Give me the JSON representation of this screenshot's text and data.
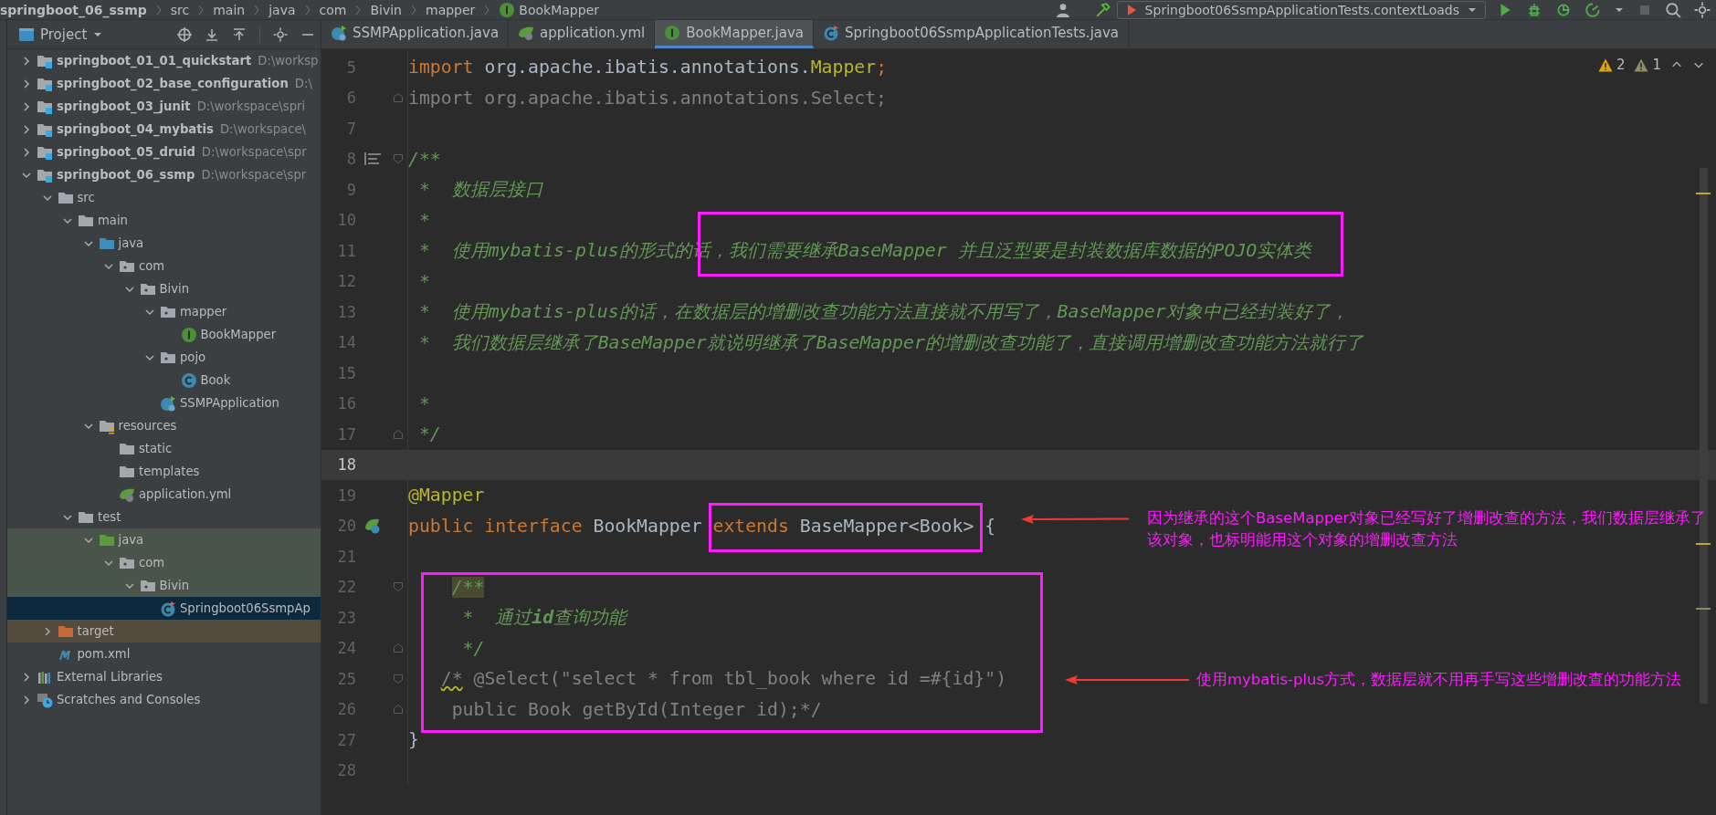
{
  "breadcrumb": [
    {
      "label": "springboot_06_ssmp"
    },
    {
      "label": "src"
    },
    {
      "label": "main"
    },
    {
      "label": "java"
    },
    {
      "label": "com"
    },
    {
      "label": "Bivin"
    },
    {
      "label": "mapper"
    },
    {
      "label": "BookMapper",
      "kind": "interface"
    }
  ],
  "run_config": {
    "label": "Springboot06SsmpApplicationTests.contextLoads"
  },
  "project_panel": {
    "title": "Project"
  },
  "tree": [
    {
      "label": "springboot_01_01_quickstart",
      "path": "D:\\worksp",
      "kind": "module",
      "expanded": false,
      "selected": false
    },
    {
      "label": "springboot_02_base_configuration",
      "path": "D:\\",
      "kind": "module",
      "expanded": false,
      "selected": false
    },
    {
      "label": "springboot_03_junit",
      "path": "D:\\workspace\\spri",
      "kind": "module",
      "expanded": false,
      "selected": false
    },
    {
      "label": "springboot_04_mybatis",
      "path": "D:\\workspace\\",
      "kind": "module",
      "expanded": false,
      "selected": false
    },
    {
      "label": "springboot_05_druid",
      "path": "D:\\workspace\\spr",
      "kind": "module",
      "expanded": false,
      "selected": false
    },
    {
      "label": "springboot_06_ssmp",
      "path": "D:\\workspace\\spr",
      "kind": "module",
      "expanded": true,
      "selected": false,
      "children": [
        {
          "label": "src",
          "kind": "folder",
          "expanded": true,
          "selected": false,
          "children": [
            {
              "label": "main",
              "kind": "folder",
              "expanded": true,
              "selected": false,
              "children": [
                {
                  "label": "java",
                  "kind": "source",
                  "expanded": true,
                  "selected": false,
                  "children": [
                    {
                      "label": "com",
                      "kind": "package",
                      "expanded": true,
                      "selected": false,
                      "children": [
                        {
                          "label": "Bivin",
                          "kind": "package",
                          "expanded": true,
                          "selected": false,
                          "children": [
                            {
                              "label": "mapper",
                              "kind": "package",
                              "expanded": true,
                              "selected": false,
                              "children": [
                                {
                                  "label": "BookMapper",
                                  "kind": "interface",
                                  "selected": false
                                }
                              ]
                            },
                            {
                              "label": "pojo",
                              "kind": "package",
                              "expanded": true,
                              "selected": false,
                              "children": [
                                {
                                  "label": "Book",
                                  "kind": "class",
                                  "selected": false
                                }
                              ]
                            },
                            {
                              "label": "SSMPApplication",
                              "kind": "spring-app",
                              "selected": false
                            }
                          ]
                        }
                      ]
                    }
                  ]
                },
                {
                  "label": "resources",
                  "kind": "resources",
                  "expanded": true,
                  "selected": false,
                  "children": [
                    {
                      "label": "static",
                      "kind": "folder",
                      "selected": false
                    },
                    {
                      "label": "templates",
                      "kind": "folder",
                      "selected": false
                    },
                    {
                      "label": "application.yml",
                      "kind": "spring-config",
                      "selected": false
                    }
                  ]
                }
              ]
            },
            {
              "label": "test",
              "kind": "folder",
              "expanded": true,
              "selected": false,
              "children": [
                {
                  "label": "java",
                  "kind": "test-source",
                  "expanded": true,
                  "selected": false,
                  "in_test": true,
                  "children": [
                    {
                      "label": "com",
                      "kind": "package",
                      "expanded": true,
                      "selected": false,
                      "in_test": true,
                      "children": [
                        {
                          "label": "Bivin",
                          "kind": "package",
                          "expanded": true,
                          "selected": false,
                          "in_test": true,
                          "children": [
                            {
                              "label": "Springboot06SsmpAp",
                              "kind": "test-class",
                              "selected": true
                            }
                          ]
                        }
                      ]
                    }
                  ]
                }
              ]
            }
          ]
        },
        {
          "label": "target",
          "kind": "excluded",
          "expanded": false,
          "selected": false,
          "excluded": true
        },
        {
          "label": "pom.xml",
          "kind": "maven",
          "selected": false
        }
      ]
    },
    {
      "label": "External Libraries",
      "kind": "libraries",
      "expanded": false,
      "selected": false
    },
    {
      "label": "Scratches and Consoles",
      "kind": "scratches",
      "expanded": false,
      "selected": false
    }
  ],
  "editor_tabs": [
    {
      "label": "SSMPApplication.java",
      "kind": "spring-app",
      "selected": false
    },
    {
      "label": "application.yml",
      "kind": "spring-config",
      "selected": false
    },
    {
      "label": "BookMapper.java",
      "kind": "interface",
      "selected": true
    },
    {
      "label": "Springboot06SsmpApplicationTests.java",
      "kind": "test-class",
      "selected": false
    }
  ],
  "inspections": [
    {
      "kind": "warning",
      "count": "2"
    },
    {
      "kind": "weak-warning",
      "count": "1"
    }
  ],
  "code_lines": [
    {
      "number": "5",
      "current": false,
      "segments": [
        {
          "kind": "keyword",
          "text": "import "
        },
        {
          "kind": "plain",
          "text": "org.apache.ibatis.annotations."
        },
        {
          "kind": "annotation",
          "text": "Mapper"
        },
        {
          "kind": "keyword",
          "text": ";"
        }
      ]
    },
    {
      "number": "6",
      "current": false,
      "fold_end": true,
      "segments": [
        {
          "kind": "unused",
          "text": "import org.apache.ibatis.annotations.Select;"
        }
      ]
    },
    {
      "number": "7",
      "current": false
    },
    {
      "number": "8",
      "current": false,
      "fold_start": true,
      "rendered_doc": true,
      "segments": [
        {
          "kind": "doc",
          "text": "/**"
        }
      ]
    },
    {
      "number": "9",
      "current": false,
      "segments": [
        {
          "kind": "doc",
          "text": " *  数据层接口"
        }
      ]
    },
    {
      "number": "10",
      "current": false,
      "segments": [
        {
          "kind": "doc",
          "text": " *"
        }
      ]
    },
    {
      "number": "11",
      "current": false,
      "segments": [
        {
          "kind": "doc",
          "text": " *  使用mybatis-plus的形式的话，我们需要继承BaseMapper 并且泛型要是封装数据库数据的POJO实体类"
        }
      ]
    },
    {
      "number": "12",
      "current": false,
      "segments": [
        {
          "kind": "doc",
          "text": " *"
        }
      ]
    },
    {
      "number": "13",
      "current": false,
      "segments": [
        {
          "kind": "doc",
          "text": " *  使用mybatis-plus的话，在数据层的增删改查功能方法直接就不用写了，BaseMapper对象中已经封装好了，"
        }
      ]
    },
    {
      "number": "14",
      "current": false,
      "segments": [
        {
          "kind": "doc",
          "text": " *  我们数据层继承了BaseMapper就说明继承了BaseMapper的增删改查功能了，直接调用增删改查功能方法就行了"
        }
      ]
    },
    {
      "number": "15",
      "current": false
    },
    {
      "number": "16",
      "current": false,
      "segments": [
        {
          "kind": "doc",
          "text": " *"
        }
      ]
    },
    {
      "number": "17",
      "current": false,
      "fold_end": true,
      "segments": [
        {
          "kind": "doc",
          "text": " */"
        }
      ]
    },
    {
      "number": "18",
      "current": true
    },
    {
      "number": "19",
      "current": false,
      "segments": [
        {
          "kind": "annotation",
          "text": "@Mapper"
        }
      ]
    },
    {
      "number": "20",
      "current": false,
      "bean": true,
      "segments": [
        {
          "kind": "keyword",
          "text": "public interface "
        },
        {
          "kind": "plain",
          "text": "BookMapper "
        },
        {
          "kind": "keyword",
          "text": "extends "
        },
        {
          "kind": "plain",
          "text": "BaseMapper<Book> {"
        }
      ]
    },
    {
      "number": "21",
      "current": false
    },
    {
      "number": "22",
      "current": false,
      "fold_start": true,
      "segments": [
        {
          "kind": "doc-marked",
          "text": "    /**"
        }
      ]
    },
    {
      "number": "23",
      "current": false,
      "segments": [
        {
          "kind": "doc",
          "text": "     *  通过**id**查询功能"
        }
      ]
    },
    {
      "number": "24",
      "current": false,
      "fold_end": true,
      "segments": [
        {
          "kind": "doc",
          "text": "     */"
        }
      ]
    },
    {
      "number": "25",
      "current": false,
      "fold_start": true,
      "segments": [
        {
          "kind": "comment-typo",
          "text": "   /*"
        },
        {
          "kind": "comment",
          "text": " @Select(\"select * from tbl_book where id =#{id}\")"
        }
      ]
    },
    {
      "number": "26",
      "current": false,
      "fold_end": true,
      "segments": [
        {
          "kind": "comment",
          "text": "    public Book getById(Integer id);*/"
        }
      ]
    },
    {
      "number": "27",
      "current": false,
      "segments": [
        {
          "kind": "plain",
          "text": "}"
        }
      ]
    },
    {
      "number": "28",
      "current": false
    }
  ],
  "notes": [
    {
      "text": "因为继承的这个BaseMapper对象已经写好了增删改查的方法，我们数据层继承了该对象，也标明能用这个对象的增删改查方法"
    },
    {
      "text": "使用mybatis-plus方式，数据层就不用再手写这些增删改查的功能方法"
    }
  ]
}
